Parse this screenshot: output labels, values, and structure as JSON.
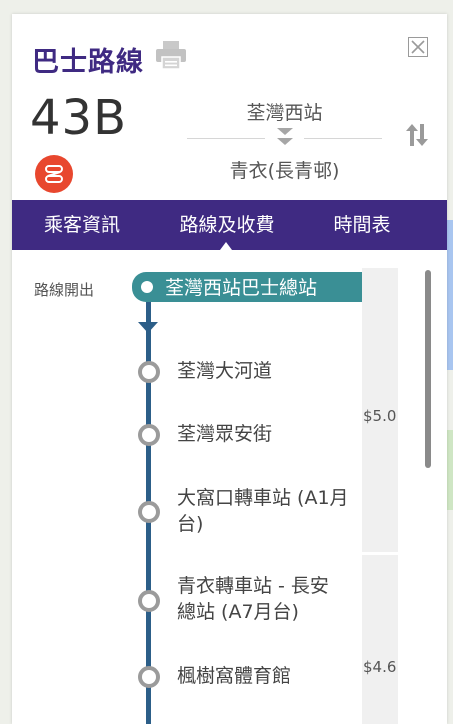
{
  "header": {
    "title": "巴士路線",
    "route_number": "43B",
    "direction_from": "荃灣西站",
    "direction_to": "青衣(長青邨)"
  },
  "tabs": [
    {
      "label": "乘客資訊"
    },
    {
      "label": "路線及收費",
      "active": true
    },
    {
      "label": "時間表"
    }
  ],
  "route": {
    "start_label": "路線開出",
    "start_stop": "荃灣西站巴士總站",
    "stops": [
      {
        "name": "荃灣大河道"
      },
      {
        "name": "荃灣眾安街"
      },
      {
        "name": "大窩口轉車站 (A1月台)"
      },
      {
        "name": "青衣轉車站 - 長安總站 (A7月台)"
      },
      {
        "name": "楓樹窩體育館"
      }
    ],
    "fares": [
      "$5.0",
      "$4.6"
    ]
  },
  "colors": {
    "brand": "#3f2a82",
    "start_stop": "#3a8f95",
    "route_line": "#2c5e88",
    "route_icon": "#e8472e"
  },
  "icons": {
    "print": "printer-icon",
    "close": "close-icon",
    "swap": "swap-direction-icon",
    "route": "route-icon"
  }
}
